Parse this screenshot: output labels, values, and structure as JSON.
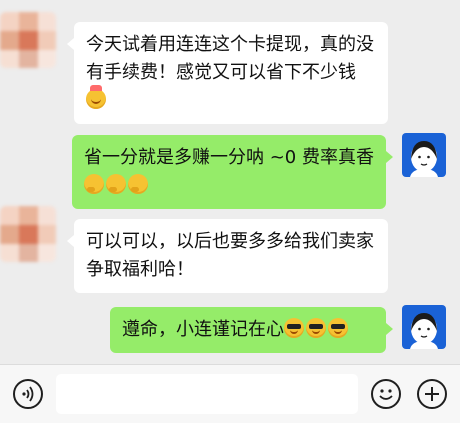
{
  "messages": [
    {
      "side": "left",
      "text": "今天试着用连连这个卡提现，真的没有手续费！感觉又可以省下不少钱",
      "emojis": [
        "party-face-icon"
      ]
    },
    {
      "side": "right",
      "text": "省一分就是多赚一分呐 ~0 费率真香",
      "emojis": [
        "thinking-face-icon",
        "thinking-face-icon",
        "thinking-face-icon"
      ]
    },
    {
      "side": "left",
      "text": "可以可以，以后也要多多给我们卖家争取福利哈！",
      "emojis": []
    },
    {
      "side": "right",
      "text": "遵命，小连谨记在心",
      "emojis": [
        "sunglasses-face-icon",
        "sunglasses-face-icon",
        "sunglasses-face-icon"
      ]
    }
  ],
  "colors": {
    "background": "#ededed",
    "incoming_bubble": "#ffffff",
    "outgoing_bubble": "#95ec69",
    "avatar_me": "#1a62d6"
  },
  "input_bar": {
    "voice_icon": "voice-icon",
    "emoji_icon": "emoji-icon",
    "plus_icon": "plus-icon",
    "value": ""
  }
}
